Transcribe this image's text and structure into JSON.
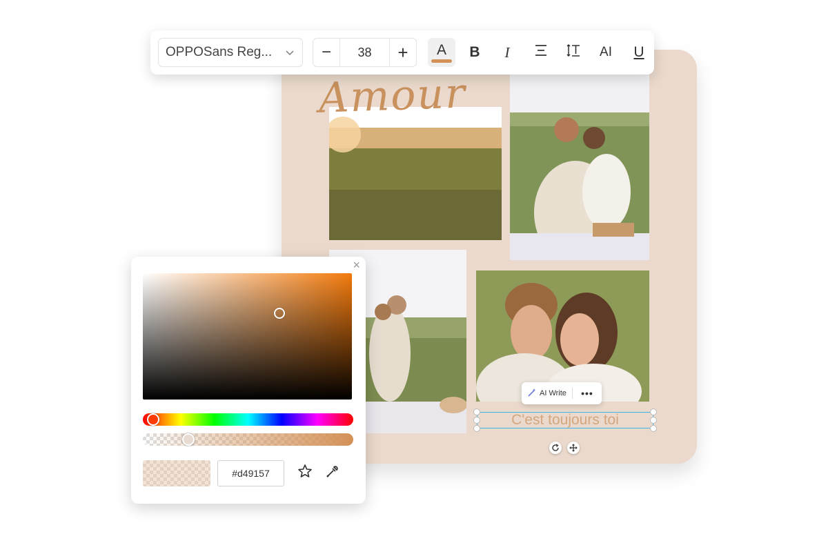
{
  "toolbar": {
    "font_family_value": "OPPOSans Reg...",
    "font_size_value": "38",
    "decrease_symbol": "−",
    "increase_symbol": "+",
    "text_color_glyph": "A",
    "text_color_swatch": "#d49157",
    "bold_glyph": "B",
    "italic_glyph": "I",
    "spacing_glyph": "AI",
    "underline_glyph": "U"
  },
  "canvas": {
    "title_text": "Amour",
    "caption_text": "C'est toujours toi",
    "background_color": "#ead9cc"
  },
  "ai_popup": {
    "ai_write_label": "AI Write",
    "more_label": "•••"
  },
  "color_picker": {
    "close_symbol": "×",
    "hex_value": "#d49157",
    "alpha_percent": 20,
    "base_hue_color": "#f27a0c"
  }
}
